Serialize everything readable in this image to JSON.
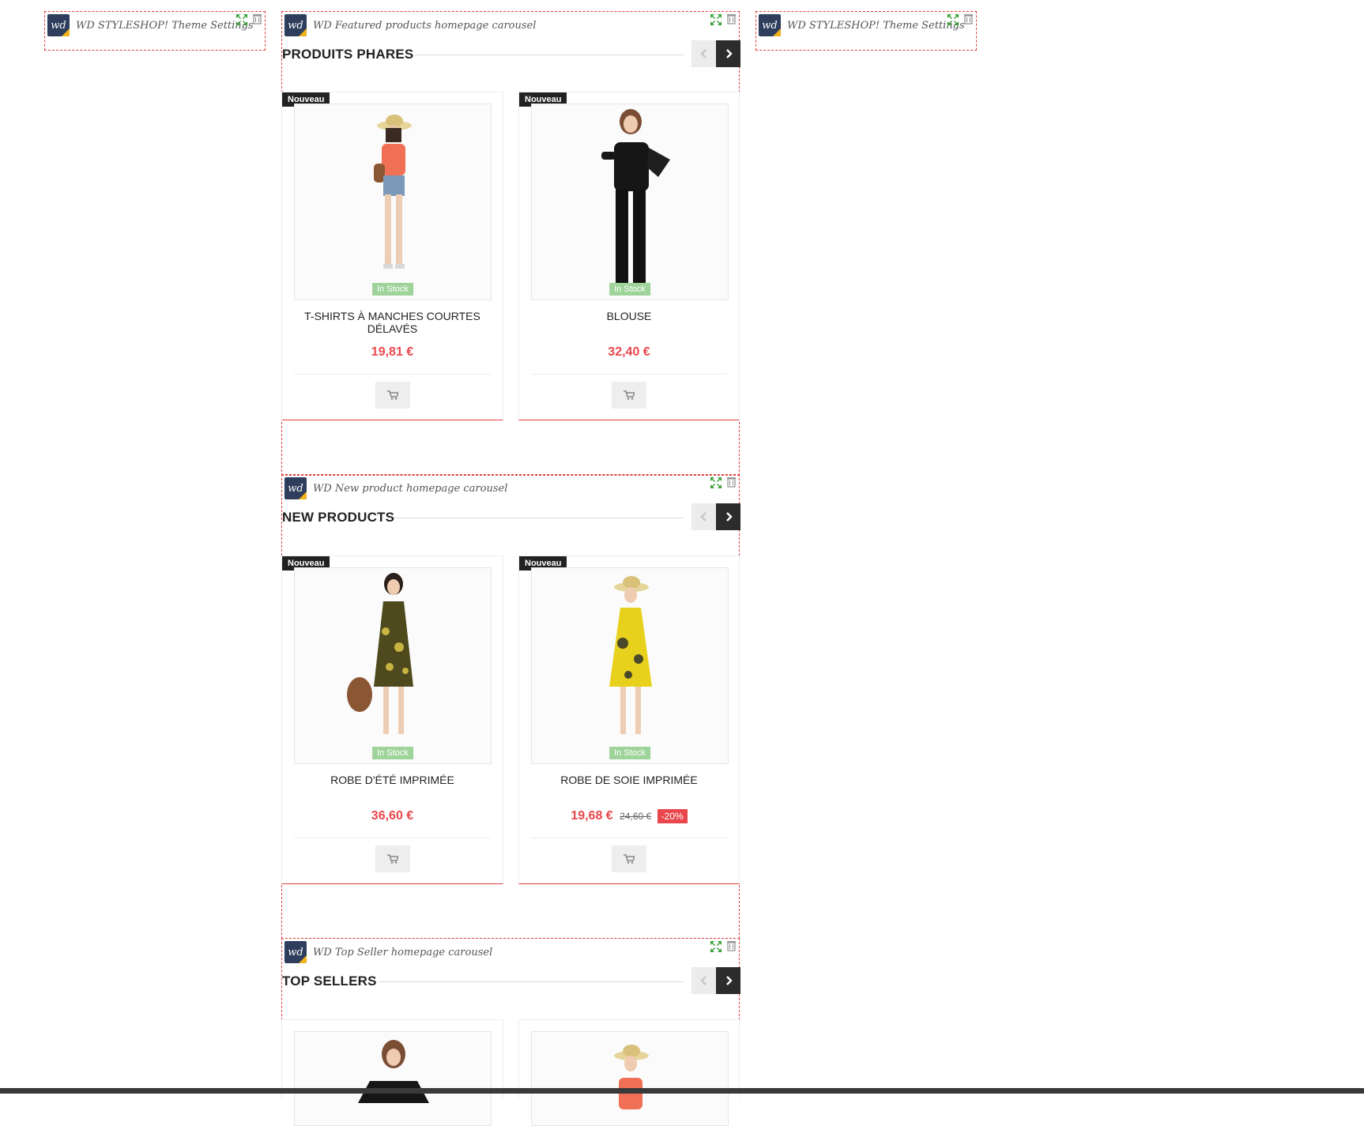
{
  "top_modules": [
    {
      "title": "WD STYLESHOP! Theme Settings"
    },
    {
      "title": "WD STYLESHOP! Theme Settings"
    }
  ],
  "carousels": [
    {
      "module_title": "WD Featured products homepage carousel",
      "heading": "PRODUITS PHARES",
      "products": [
        {
          "badge": "Nouveau",
          "stock": "In Stock",
          "name": "T-SHIRTS À MANCHES COURTES DÉLAVÉS",
          "price": "19,81 €",
          "old_price": "",
          "discount": ""
        },
        {
          "badge": "Nouveau",
          "stock": "In Stock",
          "name": "BLOUSE",
          "price": "32,40 €",
          "old_price": "",
          "discount": ""
        }
      ]
    },
    {
      "module_title": "WD New product homepage carousel",
      "heading": "NEW PRODUCTS",
      "products": [
        {
          "badge": "Nouveau",
          "stock": "In Stock",
          "name": "ROBE D'ÉTÉ IMPRIMÉE",
          "price": "36,60 €",
          "old_price": "",
          "discount": ""
        },
        {
          "badge": "Nouveau",
          "stock": "In Stock",
          "name": "ROBE DE SOIE IMPRIMÉE",
          "price": "19,68 €",
          "old_price": "24,60 €",
          "discount": "-20%"
        }
      ]
    },
    {
      "module_title": "WD Top Seller homepage carousel",
      "heading": "TOP SELLERS",
      "products": []
    }
  ],
  "logo": {
    "text": "wd"
  },
  "colors": {
    "dashed_border": "#e23b3b",
    "price": "#e9474c",
    "stock": "#9ed39a",
    "badge": "#222222",
    "nav_active": "#2c2c2c"
  },
  "icons": {
    "move": "move-arrows-icon",
    "trash": "trash-icon",
    "cart": "cart-icon",
    "prev": "chevron-left-icon",
    "next": "chevron-right-icon"
  }
}
